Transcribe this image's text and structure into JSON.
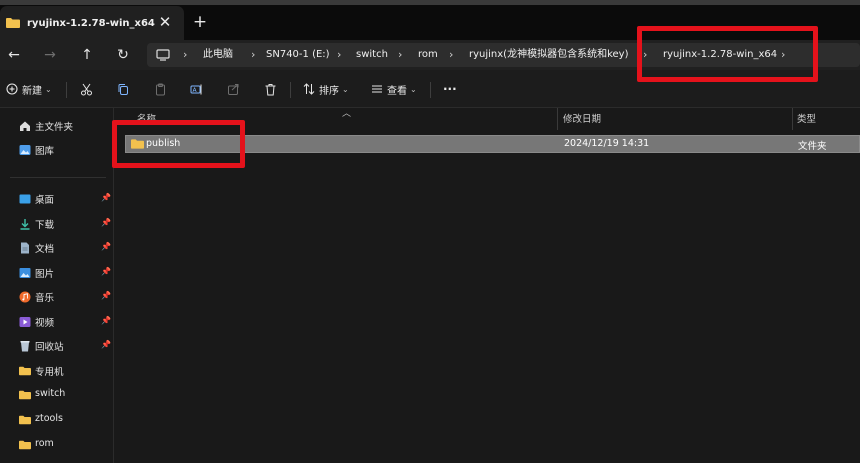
{
  "window": {
    "tab_title": "ryujinx-1.2.78-win_x64",
    "close_glyph": "✕",
    "new_tab_glyph": "+"
  },
  "nav": {
    "back": "←",
    "forward": "→",
    "up": "↑",
    "refresh": "↻",
    "breadcrumbs": [
      "此电脑",
      "SN740-1 (E:)",
      "switch",
      "rom",
      "ryujinx(龙神模拟器包含系统和key)",
      "ryujinx-1.2.78-win_x64"
    ],
    "separator": "›"
  },
  "commandbar": {
    "new_label": "新建",
    "sort_label": "排序",
    "view_label": "查看",
    "more": "···"
  },
  "sidebar": {
    "quick": [
      {
        "label": "主文件夹",
        "icon": "home-icon"
      },
      {
        "label": "图库",
        "icon": "gallery-icon"
      }
    ],
    "items": [
      {
        "label": "桌面",
        "icon": "desktop-icon",
        "pinned": true
      },
      {
        "label": "下载",
        "icon": "download-icon",
        "pinned": true
      },
      {
        "label": "文档",
        "icon": "document-icon",
        "pinned": true
      },
      {
        "label": "图片",
        "icon": "pictures-icon",
        "pinned": true
      },
      {
        "label": "音乐",
        "icon": "music-icon",
        "pinned": true
      },
      {
        "label": "视频",
        "icon": "video-icon",
        "pinned": true
      },
      {
        "label": "回收站",
        "icon": "recycle-bin-icon",
        "pinned": true
      },
      {
        "label": "专用机",
        "icon": "folder-icon",
        "pinned": false
      },
      {
        "label": "switch",
        "icon": "folder-icon",
        "pinned": false
      },
      {
        "label": "ztools",
        "icon": "folder-icon",
        "pinned": false
      },
      {
        "label": "rom",
        "icon": "folder-icon",
        "pinned": false
      }
    ],
    "pin_glyph": "📌"
  },
  "table": {
    "columns": [
      "名称",
      "修改日期",
      "类型"
    ],
    "rows": [
      {
        "name": "publish",
        "modified": "2024/12/19 14:31",
        "type": "文件夹"
      }
    ]
  },
  "colors": {
    "highlight": "#e4121b",
    "folder": "#f2c14e",
    "selection": "#777777"
  }
}
